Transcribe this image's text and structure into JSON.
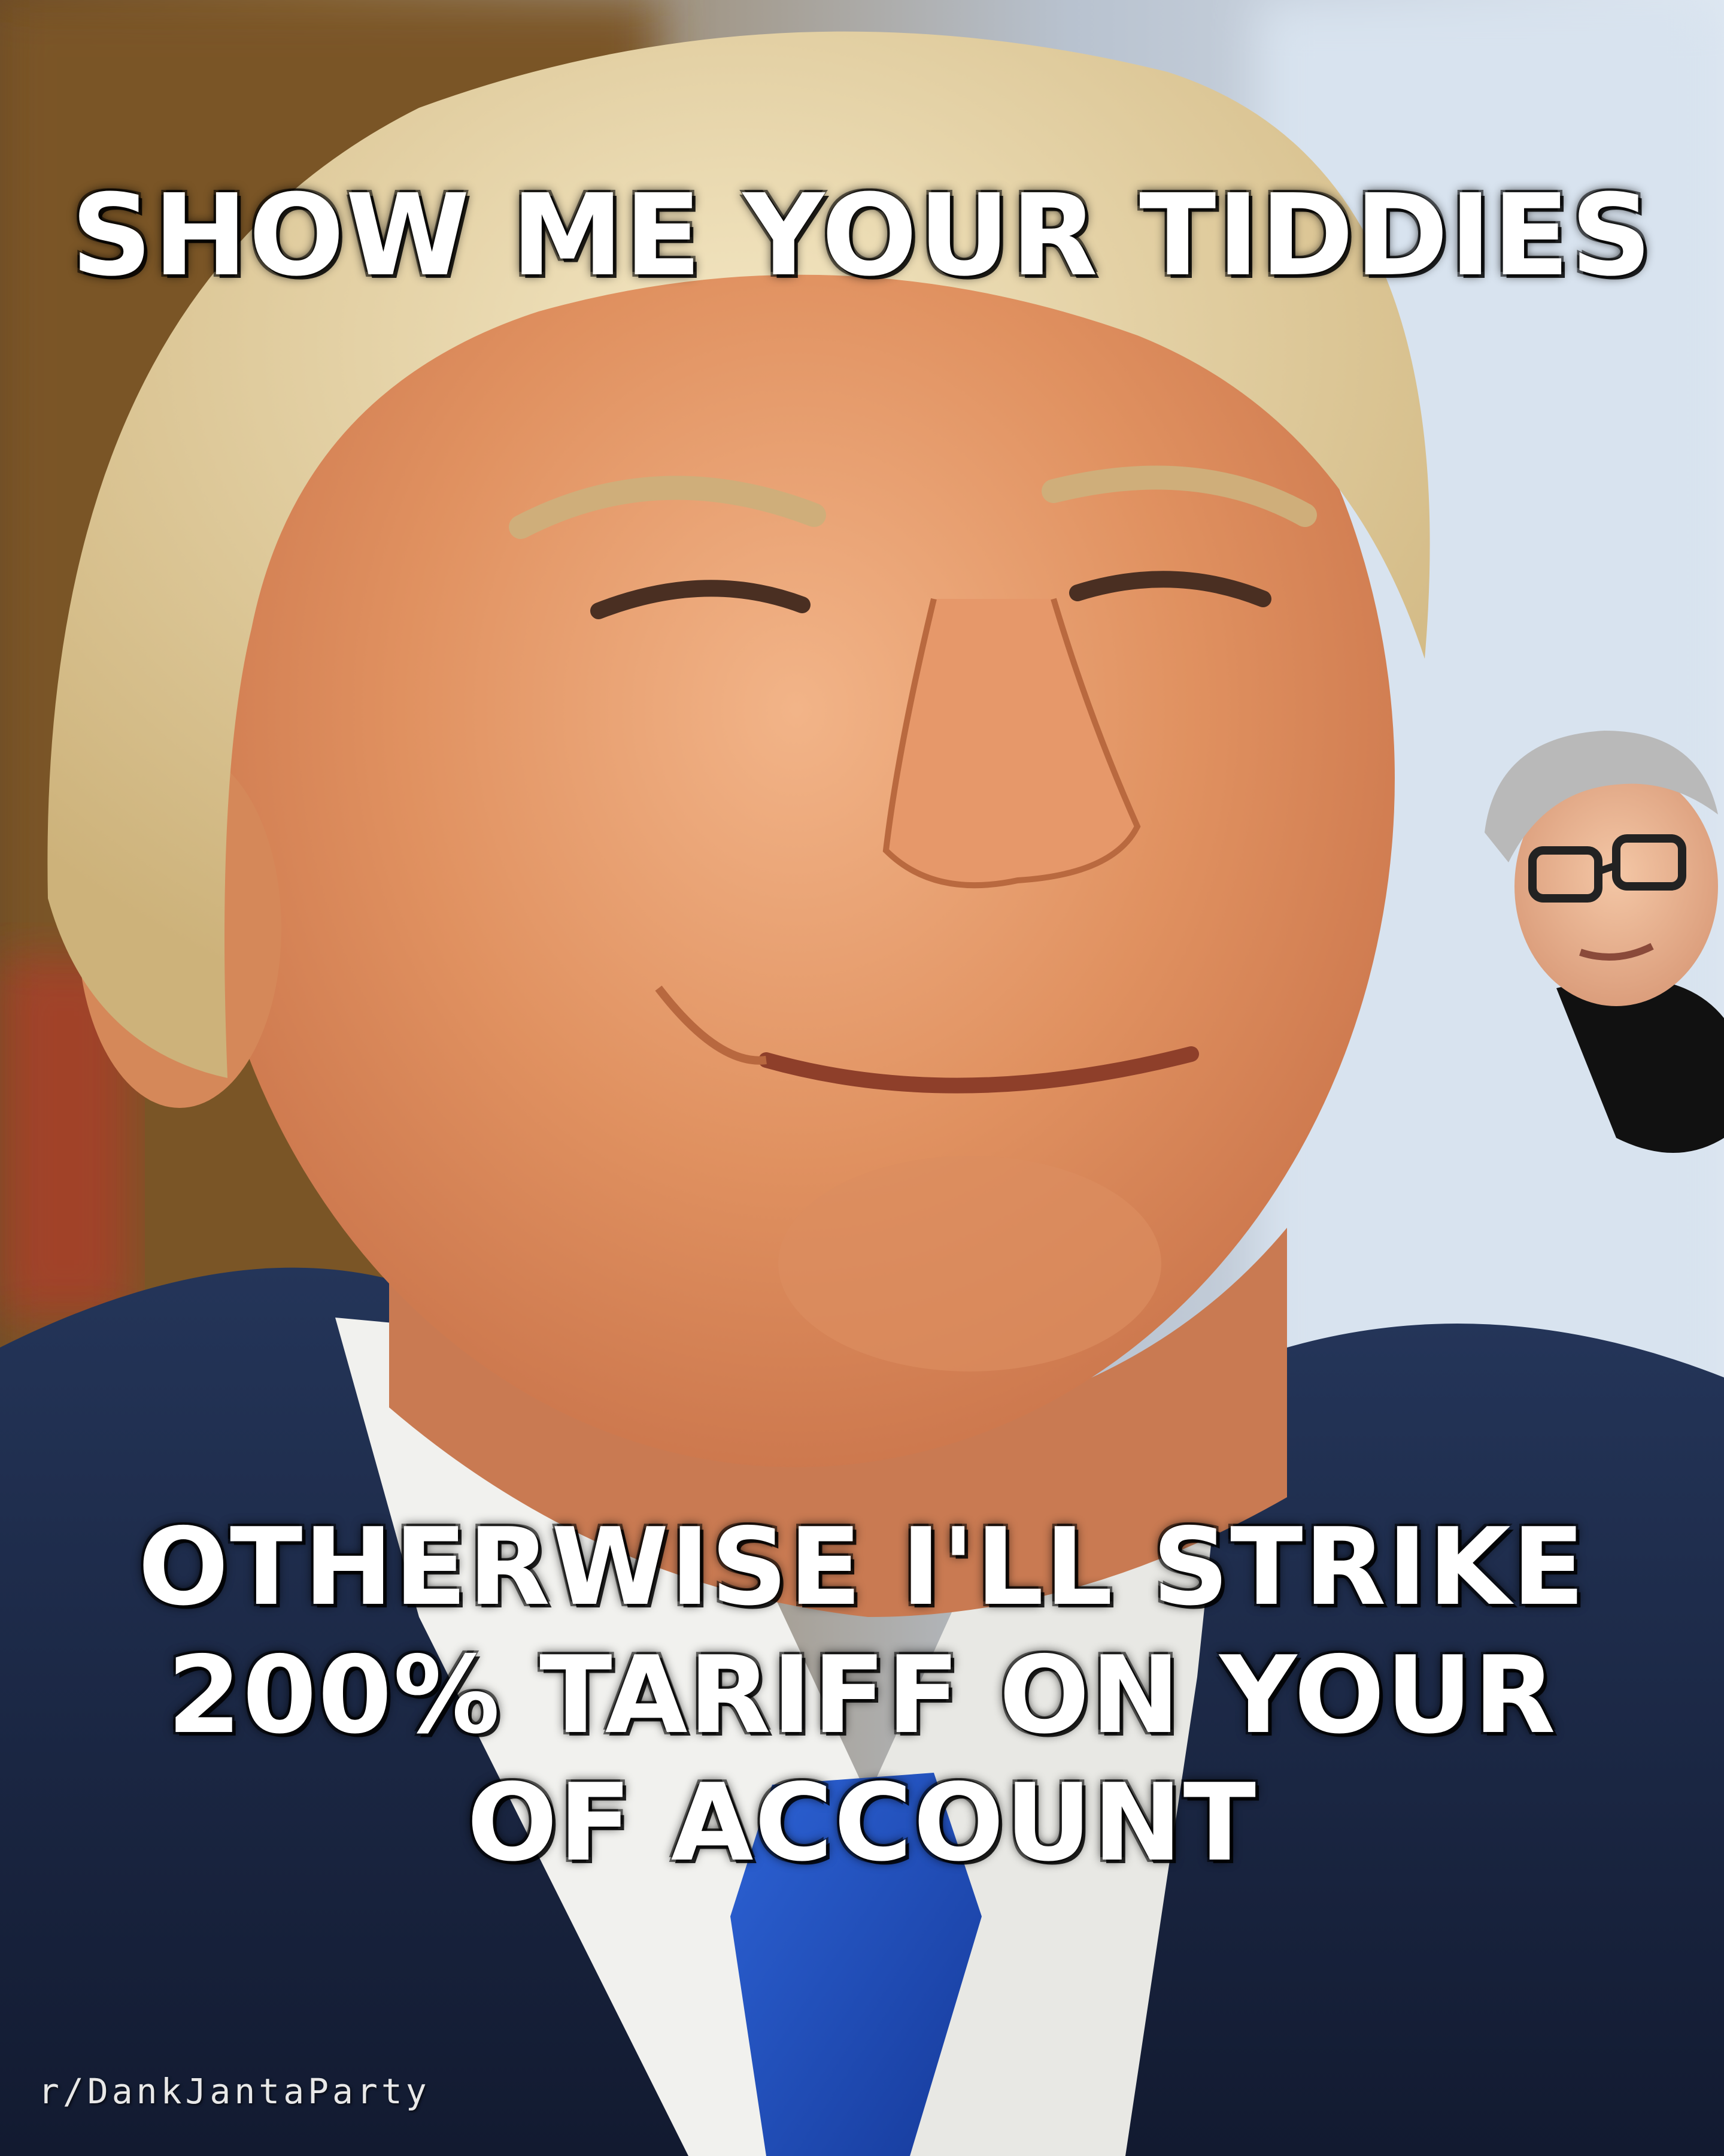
{
  "meme": {
    "top_text": "SHOW ME YOUR TIDDIES",
    "bottom_text": "OTHERWISE I'LL STRIKE 200% TARIFF ON YOUR OF ACCOUNT",
    "watermark": "r/DankJantaParty"
  },
  "colors": {
    "caption_text": "#ffffff",
    "caption_outline": "#000000",
    "suit": "#1b2a4a",
    "tie": "#1f4fbf",
    "shirt": "#f4f4f2",
    "skin": "#e39a6e",
    "hair": "#e9d7a8"
  }
}
